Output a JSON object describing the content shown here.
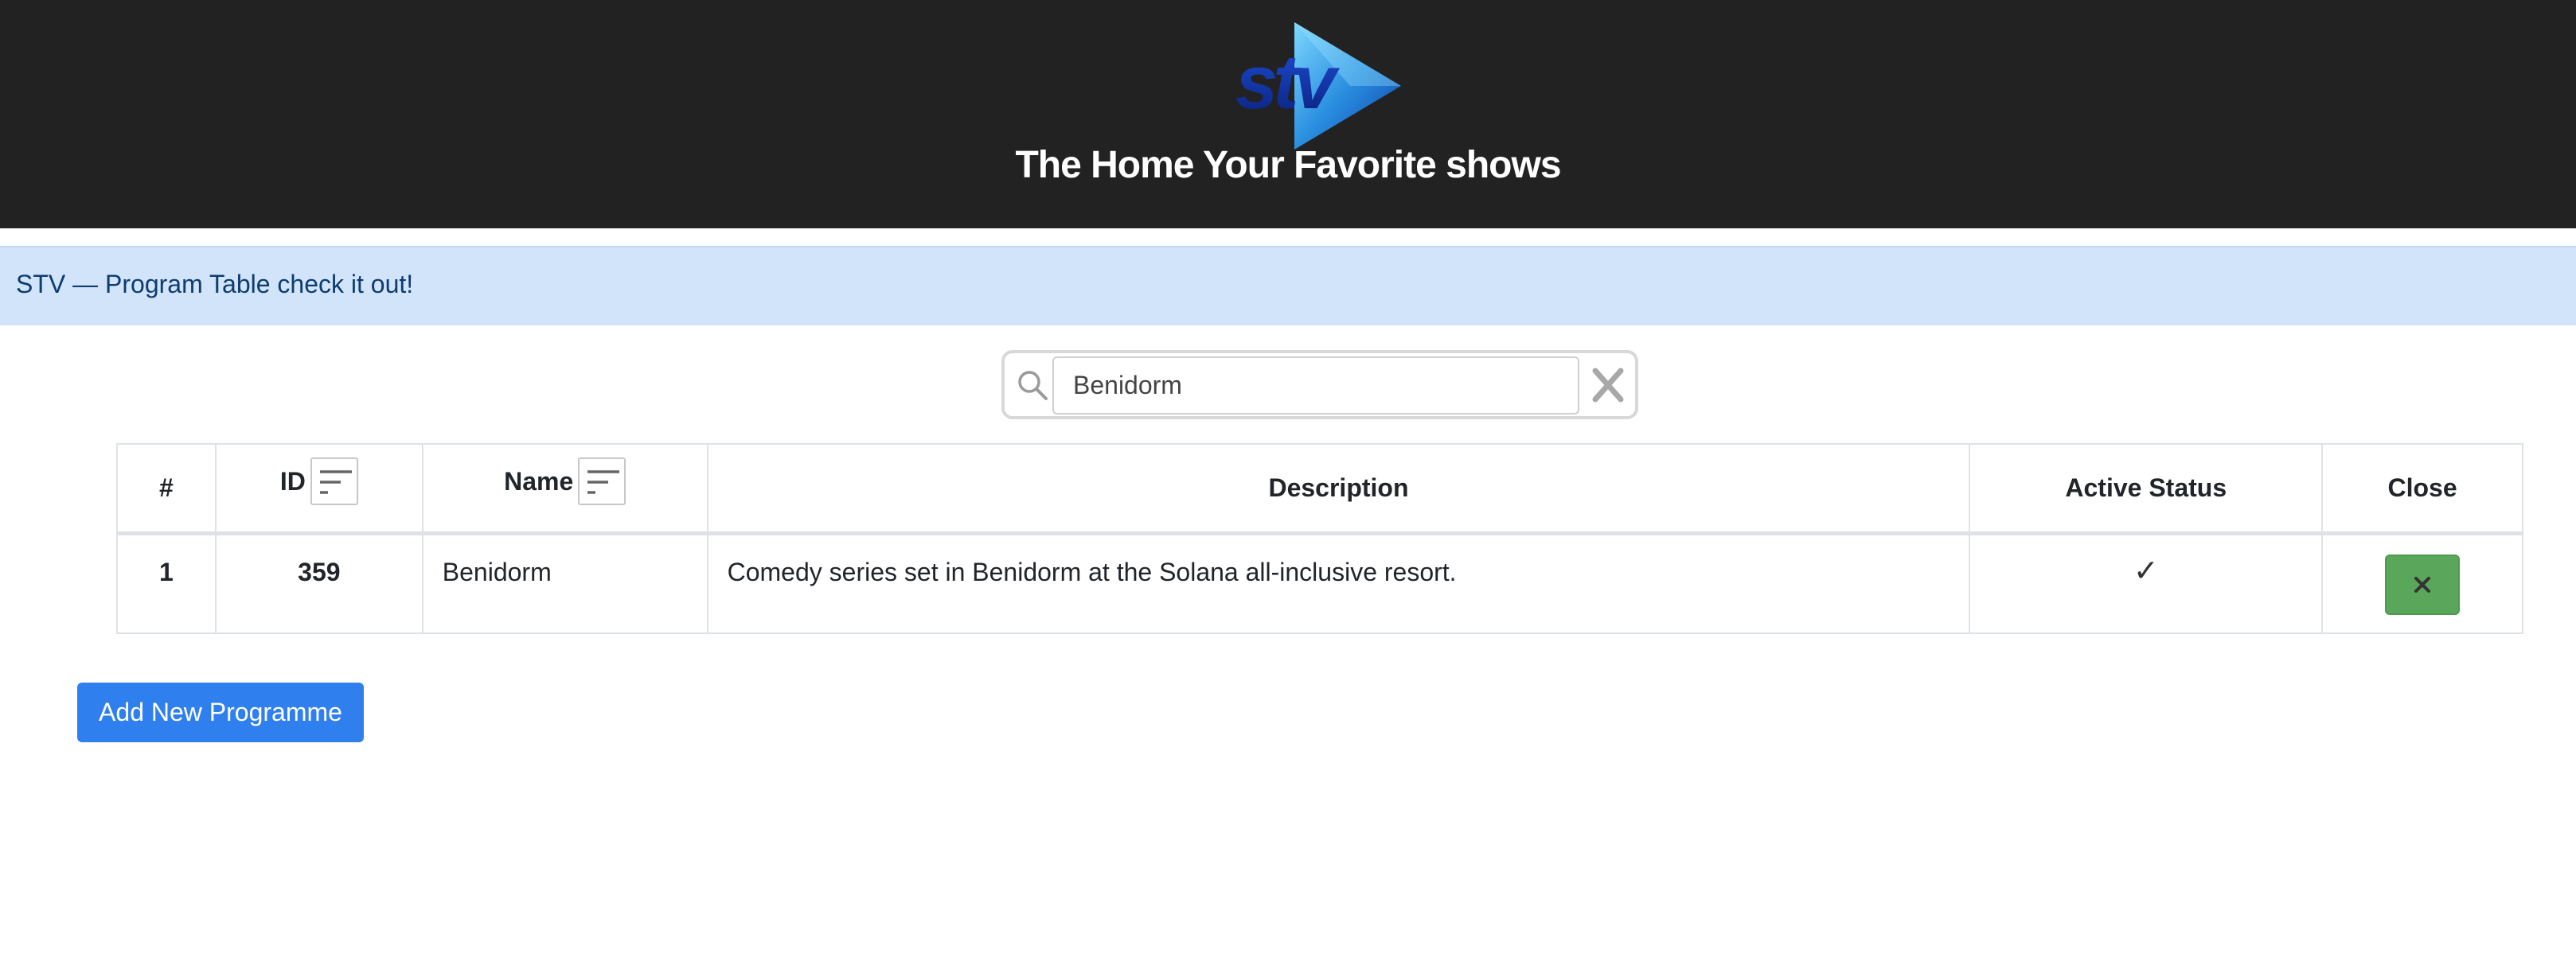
{
  "header": {
    "logo_text": "stv",
    "tagline": "The Home Your Favorite shows"
  },
  "banner": {
    "text": "STV — Program Table check it out!"
  },
  "search": {
    "value": "Benidorm",
    "icon": "search-icon",
    "clear_icon": "close-icon"
  },
  "table": {
    "headers": {
      "num": "#",
      "id": "ID",
      "name": "Name",
      "description": "Description",
      "active_status": "Active Status",
      "close": "Close"
    },
    "rows": [
      {
        "num": "1",
        "id": "359",
        "name": "Benidorm",
        "description": "Comedy series set in Benidorm at the Solana all-inclusive resort.",
        "active_status": "✓",
        "close_icon": "close-icon"
      }
    ]
  },
  "actions": {
    "add_label": "Add New Programme"
  },
  "colors": {
    "header_bg": "#222222",
    "banner_bg": "#d1e4fa",
    "primary": "#2f7fef",
    "success": "#5aa65a"
  }
}
